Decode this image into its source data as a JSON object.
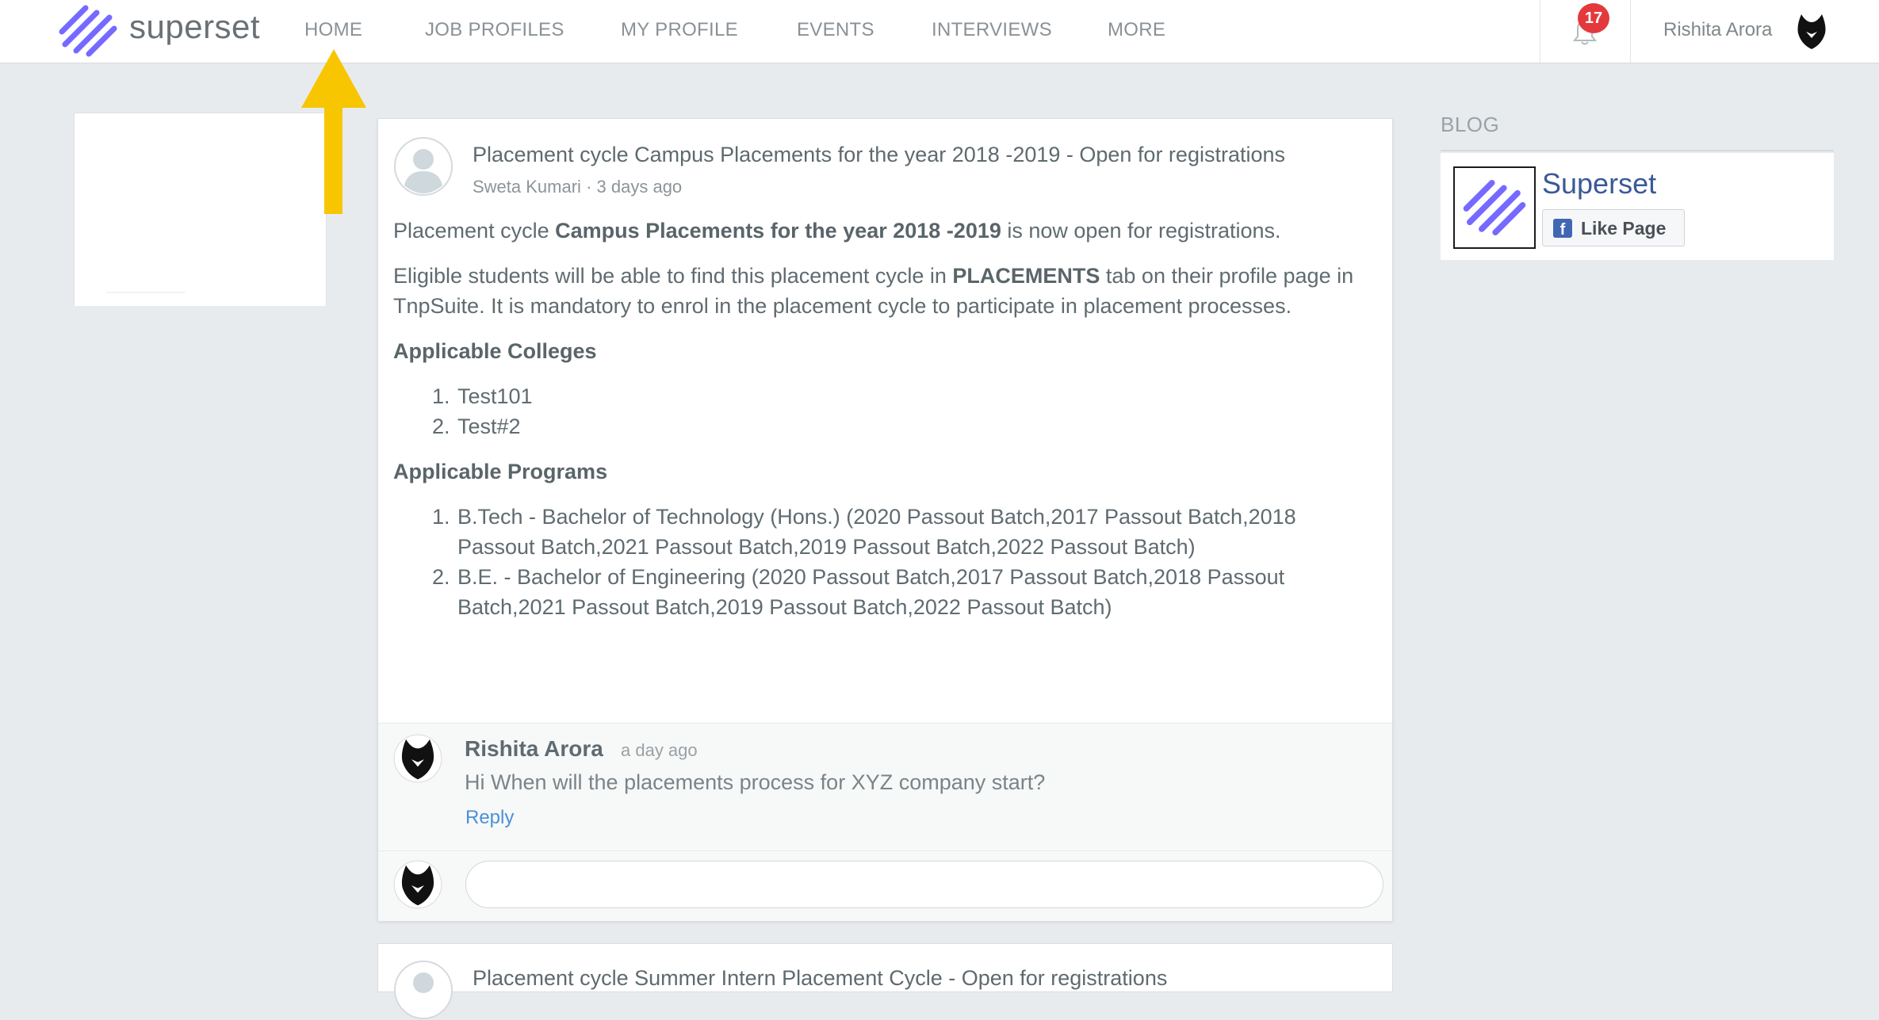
{
  "brand": {
    "name": "superset",
    "logo_icon": "superset-logo-icon"
  },
  "nav": {
    "items": [
      {
        "label": "HOME"
      },
      {
        "label": "JOB PROFILES"
      },
      {
        "label": "MY PROFILE"
      },
      {
        "label": "EVENTS"
      },
      {
        "label": "INTERVIEWS"
      },
      {
        "label": "MORE"
      }
    ],
    "notifications_count": "17",
    "user_name": "Rishita Arora"
  },
  "post": {
    "title": "Placement cycle Campus Placements for the year 2018 -2019 - Open for registrations",
    "author": "Sweta Kumari",
    "time": "3 days ago",
    "intro_prefix": "Placement cycle ",
    "intro_bold": "Campus Placements for the year 2018 -2019",
    "intro_suffix": " is now open for registrations.",
    "eligible_prefix": "Eligible students will be able to find this placement cycle in ",
    "eligible_bold": "PLACEMENTS",
    "eligible_suffix": " tab on their profile page in TnpSuite. It is mandatory to enrol in the placement cycle to participate in placement processes.",
    "colleges_heading": "Applicable Colleges",
    "colleges": [
      "Test101",
      "Test#2"
    ],
    "programs_heading": "Applicable Programs",
    "programs": [
      "B.Tech - Bachelor of Technology (Hons.) (2020 Passout Batch,2017 Passout Batch,2018 Passout Batch,2021 Passout Batch,2019 Passout Batch,2022 Passout Batch)",
      "B.E. - Bachelor of Engineering (2020 Passout Batch,2017 Passout Batch,2018 Passout Batch,2021 Passout Batch,2019 Passout Batch,2022 Passout Batch)"
    ],
    "comment": {
      "author": "Rishita Arora",
      "time": "a day ago",
      "text": "Hi When will the placements process for XYZ company start?",
      "reply_label": "Reply"
    },
    "reply_input_placeholder": ""
  },
  "next_post": {
    "title": "Placement cycle Summer Intern Placement Cycle - Open for registrations"
  },
  "blog": {
    "heading": "BLOG",
    "page_name": "Superset",
    "like_label": "Like Page"
  },
  "colors": {
    "accent_blue": "#4a90d9",
    "badge_red": "#e4393c",
    "facebook_blue": "#3b5998",
    "annotation_arrow": "#f7c600"
  }
}
